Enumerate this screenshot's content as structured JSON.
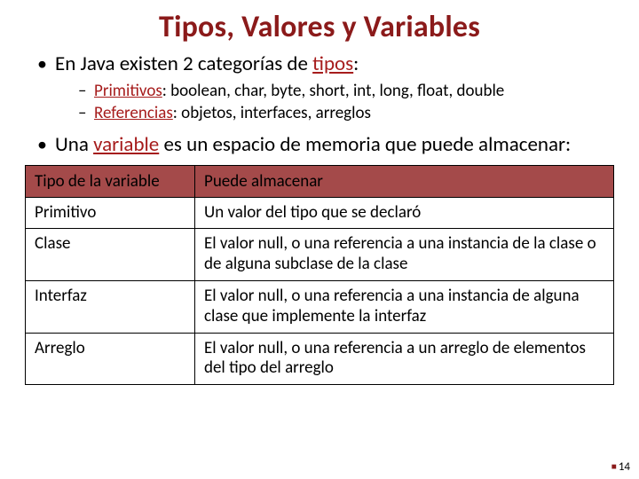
{
  "title": "Tipos, Valores y Variables",
  "bullets": {
    "b1_pre": "En Java existen 2 categorías de ",
    "b1_kw": "tipos",
    "b1_post": ":",
    "sub1_kw": "Primitivos",
    "sub1_rest": ": boolean, char, byte, short, int, long, float, double",
    "sub2_kw": "Referencias",
    "sub2_rest": ": objetos, interfaces, arreglos",
    "b2_pre": "Una ",
    "b2_kw": "variable",
    "b2_post": " es un espacio de memoria que puede almacenar:"
  },
  "table": {
    "head": {
      "c1": "Tipo de la variable",
      "c2": "Puede almacenar"
    },
    "rows": [
      {
        "c1": "Primitivo",
        "c2": "Un valor del tipo que se declaró"
      },
      {
        "c1": "Clase",
        "c2": "El valor null, o una referencia a una instancia de la clase o de alguna subclase de la clase"
      },
      {
        "c1": "Interfaz",
        "c2": "El valor null, o una referencia a una instancia de alguna clase que implemente la interfaz"
      },
      {
        "c1": "Arreglo",
        "c2": "El valor null, o una referencia a un arreglo de elementos del tipo del arreglo"
      }
    ]
  },
  "page_number": "14"
}
